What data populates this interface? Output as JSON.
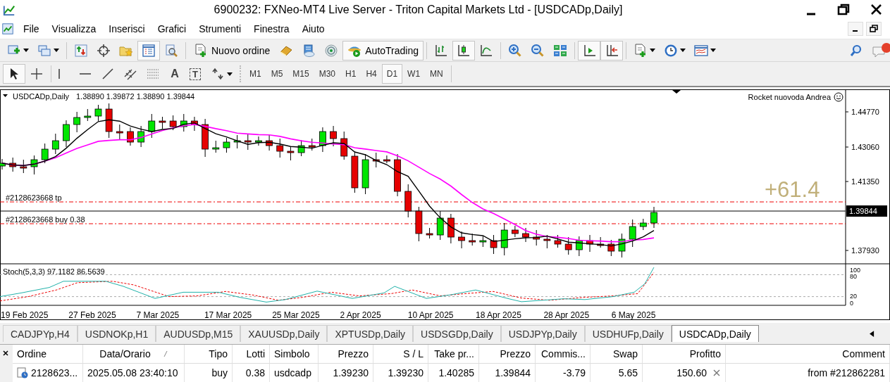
{
  "window": {
    "title": "6900232: FXNeo-MT4 Live Server - Triton Capital Markets Ltd - [USDCADp,Daily]"
  },
  "menu": [
    "File",
    "Visualizza",
    "Inserisci",
    "Grafici",
    "Strumenti",
    "Finestra",
    "Aiuto"
  ],
  "toolbar": [
    {
      "kind": "icon",
      "on": false
    },
    {
      "kind": "icon",
      "on": false
    },
    {
      "kind": "separator"
    },
    {
      "kind": "icon",
      "on": false
    },
    {
      "kind": "icon",
      "on": false
    },
    {
      "kind": "icon",
      "on": false
    },
    {
      "kind": "icon",
      "on": true
    },
    {
      "kind": "icon",
      "on": false
    },
    {
      "kind": "separator"
    },
    {
      "kind": "text",
      "label": "Nuovo ordine",
      "on": false
    },
    {
      "kind": "icon",
      "on": false
    },
    {
      "kind": "icon",
      "on": false
    },
    {
      "kind": "icon",
      "on": false
    },
    {
      "kind": "text",
      "label": "AutoTrading",
      "on": true
    },
    {
      "kind": "separator"
    },
    {
      "kind": "icon",
      "on": false
    },
    {
      "kind": "icon",
      "on": true
    },
    {
      "kind": "icon",
      "on": false
    },
    {
      "kind": "separator"
    },
    {
      "kind": "icon",
      "on": false
    },
    {
      "kind": "icon",
      "on": false
    },
    {
      "kind": "icon",
      "on": false
    },
    {
      "kind": "separator"
    },
    {
      "kind": "icon",
      "on": true
    },
    {
      "kind": "icon",
      "on": true
    },
    {
      "kind": "separator"
    },
    {
      "kind": "icon",
      "on": false
    },
    {
      "kind": "icon",
      "on": false
    },
    {
      "kind": "icon",
      "on": false
    }
  ],
  "drawing_tools": [
    {
      "kind": "icon",
      "on": true
    },
    {
      "kind": "icon",
      "on": false
    },
    {
      "kind": "separator"
    },
    {
      "kind": "icon",
      "on": false
    },
    {
      "kind": "icon",
      "on": false
    },
    {
      "kind": "icon",
      "on": false
    },
    {
      "kind": "icon",
      "on": false
    },
    {
      "kind": "icon",
      "on": false
    },
    {
      "kind": "text",
      "label": "A",
      "on": false
    },
    {
      "kind": "boxed",
      "label": "T",
      "on": false
    },
    {
      "kind": "icon",
      "on": false
    }
  ],
  "timeframes": [
    {
      "label": "M1",
      "selected": false
    },
    {
      "label": "M5",
      "selected": false
    },
    {
      "label": "M15",
      "selected": false
    },
    {
      "label": "M30",
      "selected": false
    },
    {
      "label": "H1",
      "selected": false
    },
    {
      "label": "H4",
      "selected": false
    },
    {
      "label": "D1",
      "selected": true
    },
    {
      "label": "W1",
      "selected": false
    },
    {
      "label": "MN",
      "selected": false
    }
  ],
  "chart": {
    "symbol": "USDCADp,Daily",
    "quotes": "1.38890 1.39872 1.38890 1.39844",
    "expert": "Rocket nuovoda Andrea",
    "price_labels": [
      "1.44770",
      "1.43060",
      "1.41350",
      "1.37930"
    ],
    "current_price": "1.39844",
    "profit": "+61.4",
    "order_lines": [
      {
        "label": "#2128623668 tp"
      },
      {
        "label": "#2128623668 buy 0.38"
      }
    ],
    "indicator": "Stoch(5,3,3) 97.1182 86.5639",
    "indicator_levels": [
      "100",
      "80",
      "20",
      "0"
    ],
    "dates": [
      "19 Feb 2025",
      "27 Feb 2025",
      "7 Mar 2025",
      "17 Mar 2025",
      "25 Mar 2025",
      "2 Apr 2025",
      "10 Apr 2025",
      "18 Apr 2025",
      "28 Apr 2025",
      "6 May 2025"
    ]
  },
  "chart_tabs": [
    {
      "label": "CADJPYp,H4",
      "selected": false
    },
    {
      "label": "USDNOKp,H1",
      "selected": false
    },
    {
      "label": "AUDUSDp,M15",
      "selected": false
    },
    {
      "label": "XAUUSDp,Daily",
      "selected": false
    },
    {
      "label": "XPTUSDp,Daily",
      "selected": false
    },
    {
      "label": "USDSGDp,Daily",
      "selected": false
    },
    {
      "label": "USDJPYp,Daily",
      "selected": false
    },
    {
      "label": "USDHUFp,Daily",
      "selected": false
    },
    {
      "label": "USDCADp,Daily",
      "selected": true
    }
  ],
  "orders": {
    "columns": [
      "Ordine",
      "Data/Orario",
      "Tipo",
      "Lotti",
      "Simbolo",
      "Prezzo",
      "S / L",
      "Take pr...",
      "Prezzo",
      "Commis...",
      "Swap",
      "Profitto",
      "Comment"
    ],
    "rows": [
      [
        "2128623...",
        "2025.05.08 23:40:10",
        "buy",
        "0.38",
        "usdcadp",
        "1.39230",
        "1.39230",
        "1.40285",
        "1.39844",
        "-3.79",
        "5.65",
        "150.60",
        "from #212862281"
      ]
    ]
  }
}
